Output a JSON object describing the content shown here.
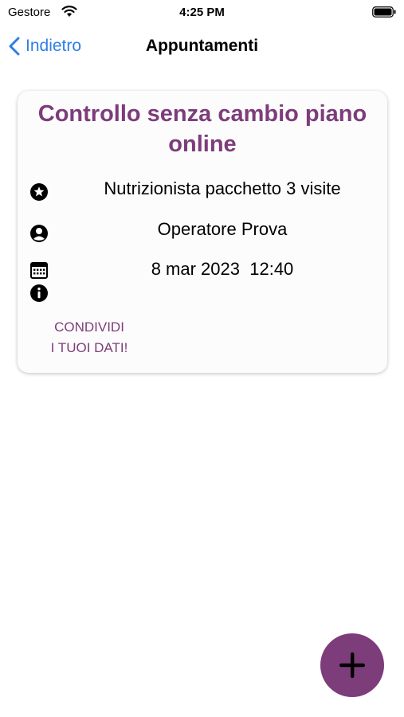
{
  "status_bar": {
    "carrier": "Gestore",
    "time": "4:25 PM"
  },
  "nav": {
    "back_label": "Indietro",
    "title": "Appuntamenti"
  },
  "appointment": {
    "title": "Controllo senza cambio piano online",
    "service": "Nutrizionista pacchetto 3 visite",
    "operator": "Operatore Prova",
    "date": "8 mar 2023",
    "time": "12:40",
    "share_line1": "CONDIVIDI",
    "share_line2": "I TUOI DATI!"
  },
  "icons": {
    "service": "star-circle-icon",
    "operator": "person-circle-icon",
    "date": "calendar-icon",
    "info": "info-circle-icon",
    "add": "plus-icon"
  },
  "colors": {
    "accent": "#7d3c7a",
    "link": "#2f7fe3"
  }
}
